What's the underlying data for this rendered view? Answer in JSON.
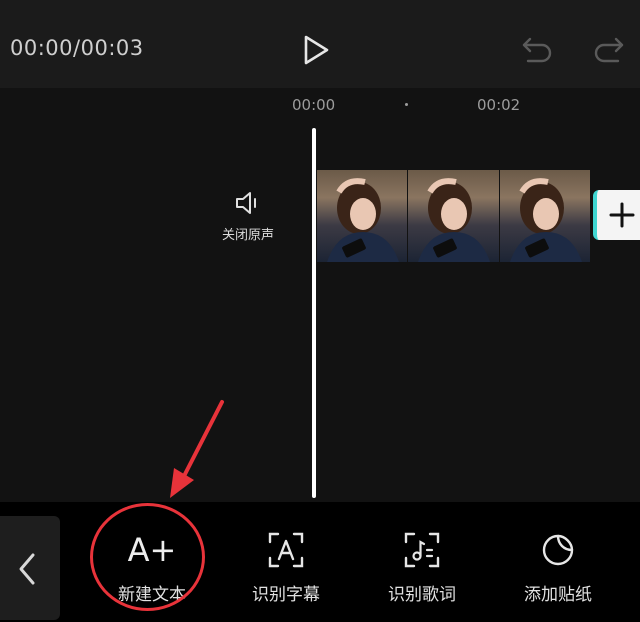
{
  "header": {
    "time_readout": "00:00/00:03",
    "play_icon": "play-icon",
    "undo_icon": "undo-icon",
    "redo_icon": "redo-icon"
  },
  "timeline": {
    "ruler_labels": [
      "00:00",
      "00:02"
    ],
    "mute_label": "关闭原声",
    "mute_icon": "speaker-icon",
    "clip_frames": 3,
    "add_clip_icon": "plus-icon"
  },
  "toolbar": {
    "back_icon": "chevron-left-icon",
    "tools": [
      {
        "label": "新建文本",
        "glyph": "A+",
        "icon": "text-add-icon"
      },
      {
        "label": "识别字幕",
        "icon": "subtitle-recognize-icon"
      },
      {
        "label": "识别歌词",
        "icon": "lyrics-recognize-icon"
      },
      {
        "label": "添加贴纸",
        "icon": "sticker-icon"
      }
    ]
  },
  "annotation": {
    "color": "#e8333a",
    "shape": "circle-and-arrow"
  },
  "colors": {
    "accent": "#3fd6d2",
    "background": "#121212",
    "topbar": "#1b1b1b"
  }
}
